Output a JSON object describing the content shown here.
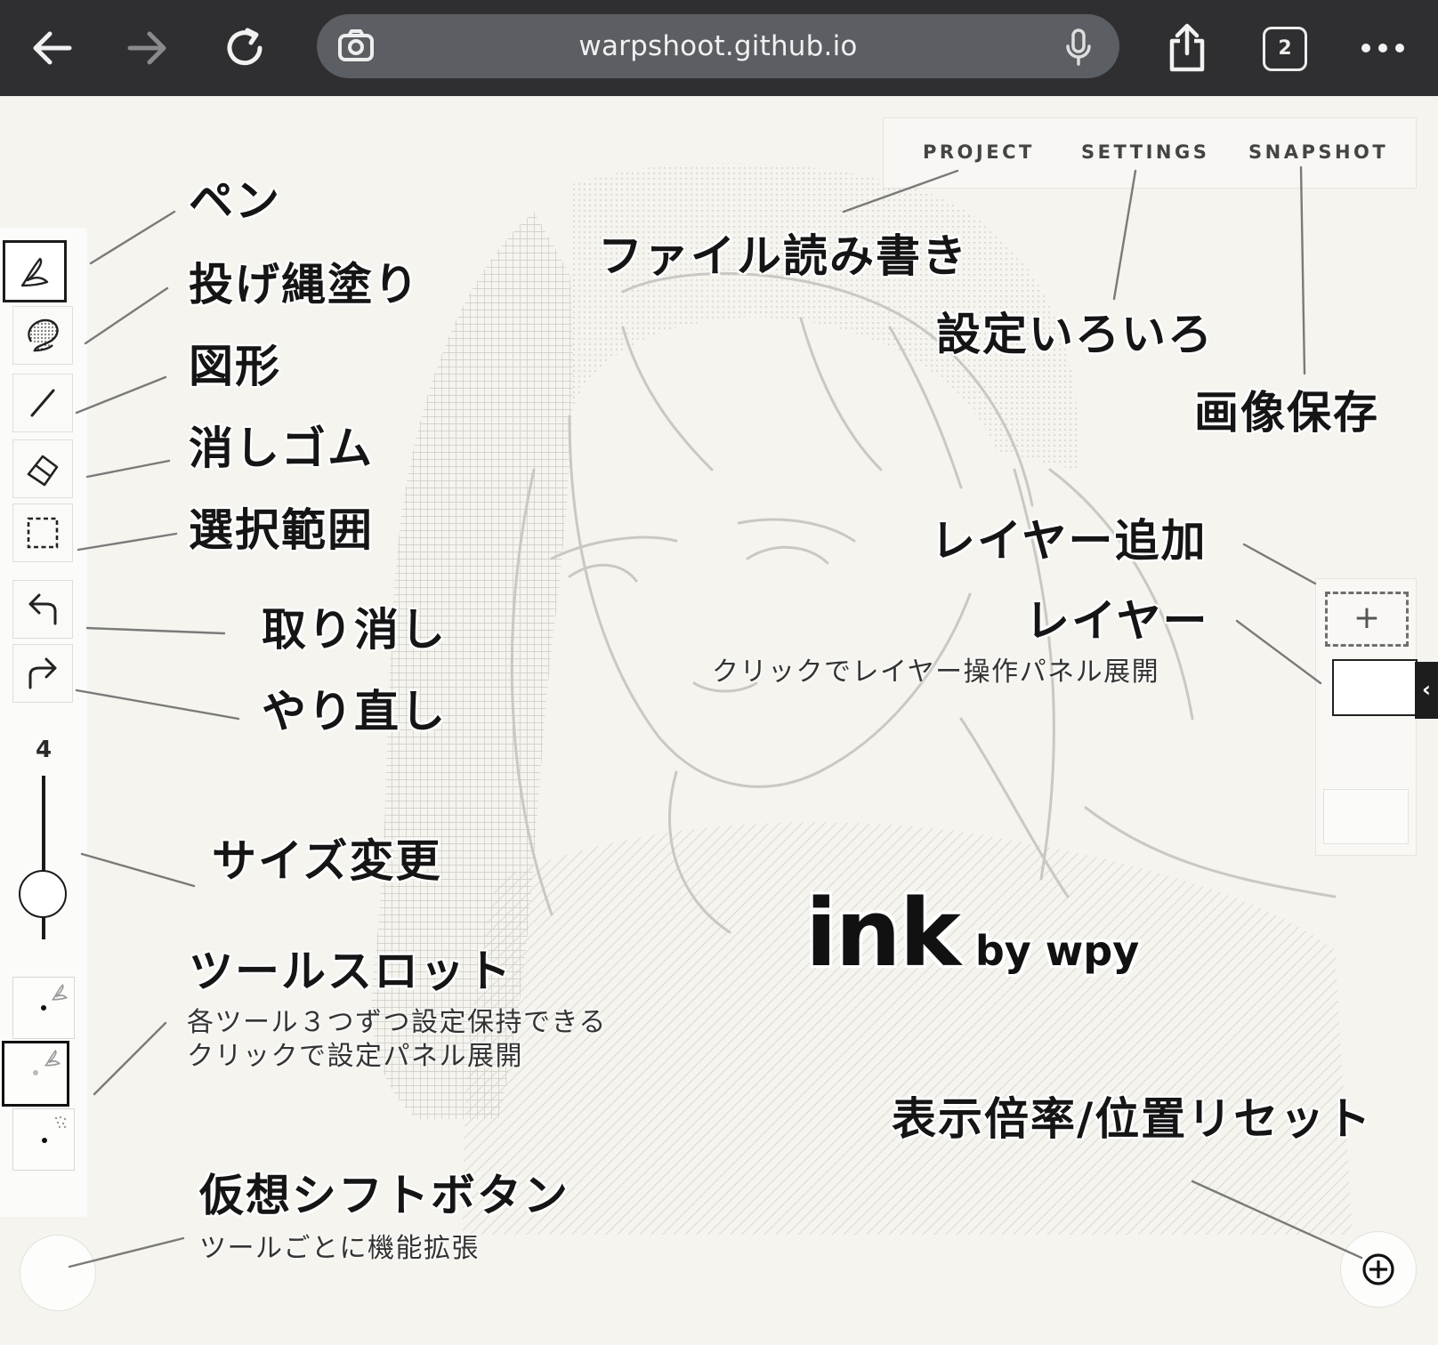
{
  "browser": {
    "url": "warpshoot.github.io",
    "tab_count": "2",
    "icons": [
      "back-arrow-icon",
      "forward-arrow-icon",
      "reload-icon",
      "camera-search-icon",
      "microphone-icon",
      "share-icon",
      "tabs-icon",
      "more-icon"
    ]
  },
  "menu": {
    "project": "PROJECT",
    "settings": "SETTINGS",
    "snapshot": "SNAPSHOT"
  },
  "toolbar": {
    "size_value": "4",
    "tools": [
      "pen-icon",
      "lasso-fill-icon",
      "line-shape-icon",
      "eraser-icon",
      "selection-icon",
      "undo-icon",
      "redo-icon"
    ]
  },
  "annotations": {
    "pen": "ペン",
    "lasso_fill": "投げ縄塗り",
    "shape": "図形",
    "eraser": "消しゴム",
    "selection": "選択範囲",
    "undo": "取り消し",
    "redo": "やり直し",
    "size": "サイズ変更",
    "tool_slot": "ツールスロット",
    "tool_slot_sub1": "各ツール３つずつ設定保持できる",
    "tool_slot_sub2": "クリックで設定パネル展開",
    "virtual_shift": "仮想シフトボタン",
    "virtual_shift_sub": "ツールごとに機能拡張",
    "file_io": "ファイル読み書き",
    "settings": "設定いろいろ",
    "save_image": "画像保存",
    "add_layer": "レイヤー追加",
    "layer": "レイヤー",
    "layer_sub": "クリックでレイヤー操作パネル展開",
    "zoom_reset": "表示倍率/位置リセット"
  },
  "logo": {
    "main": "ink",
    "by": "by wpy"
  },
  "layer_panel": {
    "add_symbol": "+",
    "tab_symbol": "‹"
  },
  "colors": {
    "chrome": "#2f2f31",
    "urlbar": "#5b5e63",
    "canvas": "#f5f4ef",
    "ink": "#151515"
  }
}
